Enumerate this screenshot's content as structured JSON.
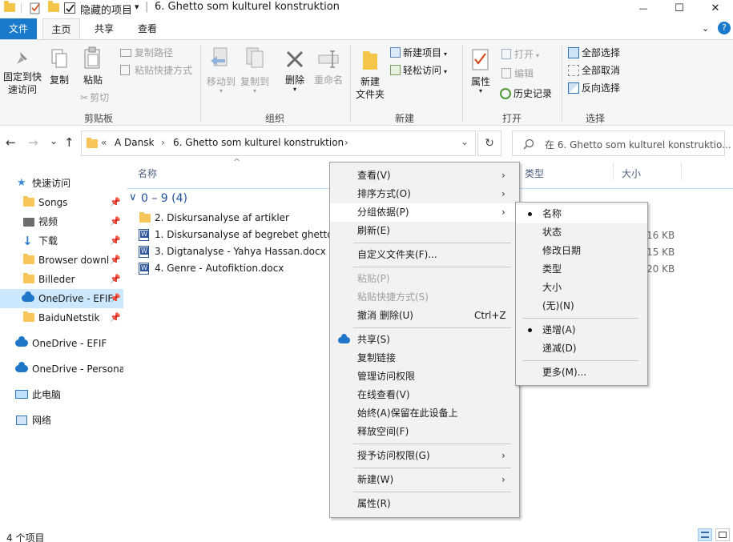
{
  "titlebar": {
    "qa_hidden_items": "隐藏的项目",
    "qa_dropdown": "▾",
    "separator": "|",
    "title": "6. Ghetto som kulturel konstruktion",
    "minimize": "—",
    "maximize": "☐",
    "close": "✕"
  },
  "tabs": {
    "file": "文件",
    "home": "主页",
    "share": "共享",
    "view": "查看",
    "collapse": "⌄",
    "help": "?"
  },
  "ribbon": {
    "clipboard": {
      "label": "剪贴板",
      "pin_quick_access_1": "固定到快",
      "pin_quick_access_2": "速访问",
      "copy": "复制",
      "paste": "粘贴",
      "copy_path": "复制路径",
      "paste_shortcut": "粘贴快捷方式",
      "cut": "剪切"
    },
    "organize": {
      "label": "组织",
      "move_to": "移动到",
      "copy_to": "复制到",
      "delete": "删除",
      "rename": "重命名"
    },
    "new": {
      "label": "新建",
      "new_folder_1": "新建",
      "new_folder_2": "文件夹",
      "new_item": "新建项目",
      "easy_access": "轻松访问"
    },
    "open": {
      "label": "打开",
      "properties": "属性",
      "open": "打开",
      "edit": "编辑",
      "history": "历史记录"
    },
    "select": {
      "label": "选择",
      "select_all": "全部选择",
      "select_none": "全部取消",
      "invert": "反向选择"
    }
  },
  "address": {
    "back": "←",
    "forward": "→",
    "recent": "⌄",
    "up": "↑",
    "overflow": "«",
    "crumb1": "A Dansk",
    "crumb_sep": "›",
    "crumb2": "6. Ghetto som kulturel konstruktion",
    "dropdown": "⌄",
    "refresh": "↻",
    "search_placeholder": "在 6. Ghetto som kulturel konstruktio..."
  },
  "navpane": {
    "quick_access": "快速访问",
    "pin": "📌",
    "items": [
      {
        "label": "Songs"
      },
      {
        "label": "视频"
      },
      {
        "label": "下载"
      },
      {
        "label": "Browser downl"
      },
      {
        "label": "Billeder"
      },
      {
        "label": "OneDrive - EFIF"
      },
      {
        "label": "BaiduNetstik"
      }
    ],
    "onedrive_efif": "OneDrive - EFIF",
    "onedrive_personal": "OneDrive - Persona",
    "this_pc": "此电脑",
    "network": "网络"
  },
  "filelist": {
    "col_name": "名称",
    "col_type": "类型",
    "col_size": "大小",
    "sort_arrow": "^",
    "group_chevron": "∨",
    "group_title": "0 – 9 (4)",
    "files": [
      {
        "name": "2. Diskursanalyse af artikler",
        "size": ""
      },
      {
        "name": "1. Diskursanalyse af begrebet ghetto...",
        "size": "16 KB"
      },
      {
        "name": "3. Digtanalyse - Yahya Hassan.docx",
        "size": "15 KB"
      },
      {
        "name": "4. Genre - Autofiktion.docx",
        "size": "20 KB"
      }
    ]
  },
  "status": {
    "count": "4 个项目"
  },
  "context_menu": {
    "view": "查看(V)",
    "sort_by": "排序方式(O)",
    "group_by": "分组依据(P)",
    "refresh": "刷新(E)",
    "customize": "自定义文件夹(F)...",
    "paste": "粘贴(P)",
    "paste_shortcut": "粘贴快捷方式(S)",
    "undo_delete": "撤消 删除(U)",
    "undo_shortcut": "Ctrl+Z",
    "share": "共享(S)",
    "copy_link": "复制链接",
    "manage_access": "管理访问权限",
    "view_online": "在线查看(V)",
    "always_keep": "始终(A)保留在此设备上",
    "free_space": "释放空间(F)",
    "give_access": "授予访问权限(G)",
    "new": "新建(W)",
    "properties": "属性(R)",
    "arrow": "›"
  },
  "group_submenu": {
    "name": "名称",
    "status": "状态",
    "date_modified": "修改日期",
    "type": "类型",
    "size": "大小",
    "none": "(无)(N)",
    "ascending": "递增(A)",
    "descending": "递减(D)",
    "more": "更多(M)..."
  }
}
